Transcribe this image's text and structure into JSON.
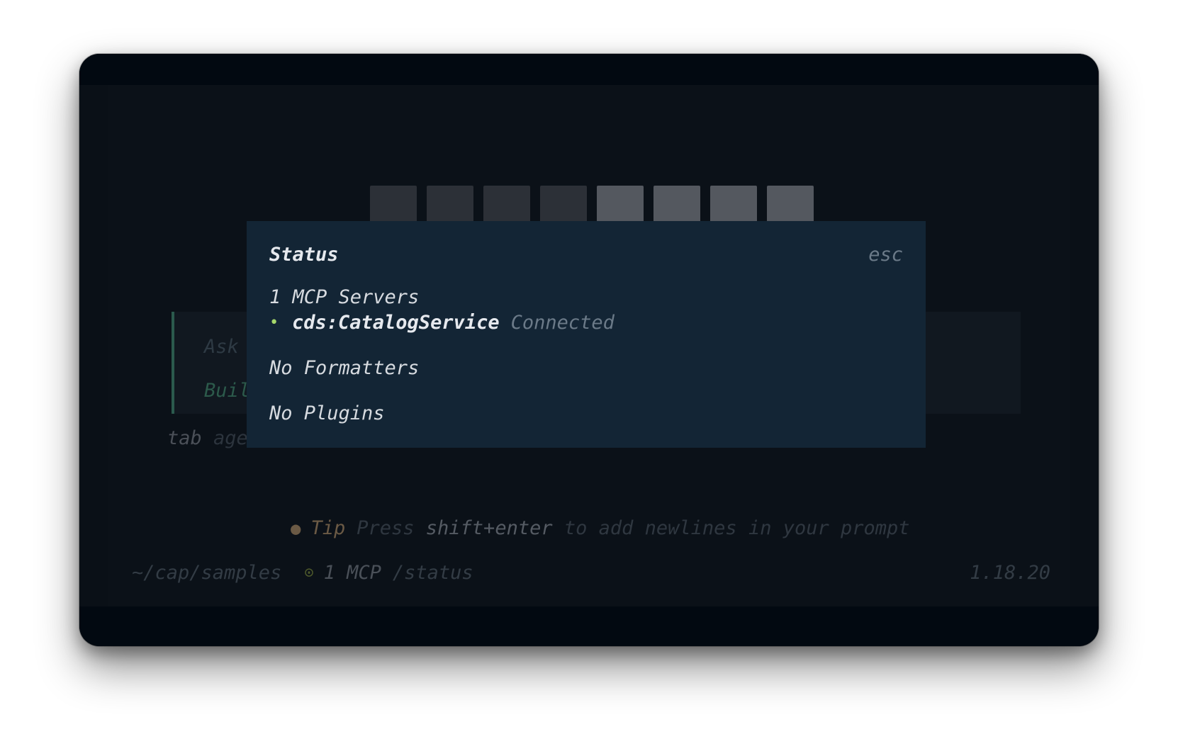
{
  "background": {
    "logo_text": "opencode",
    "prompt": {
      "placeholder_visible": "Ask",
      "agent_visible": "Buil"
    },
    "tab_hint": {
      "key": "tab",
      "label_visible": "age"
    },
    "tip": {
      "label": "Tip",
      "text_before": "Press",
      "key": "shift+enter",
      "text_after": "to add newlines in your prompt"
    },
    "statusline": {
      "path": "~/cap/samples",
      "mcp_count": "1 MCP",
      "command": "/status",
      "version": "1.18.20"
    }
  },
  "modal": {
    "title": "Status",
    "close_hint": "esc",
    "mcp_heading": "1 MCP Servers",
    "servers": [
      {
        "name": "cds:CatalogService",
        "state": "Connected"
      }
    ],
    "formatters": "No Formatters",
    "plugins": "No Plugins"
  },
  "colors": {
    "modal_bg": "#132535",
    "connected_bullet": "#a6d86b",
    "accent_border": "#2b5a4d",
    "tip_accent": "#6b5a45"
  }
}
